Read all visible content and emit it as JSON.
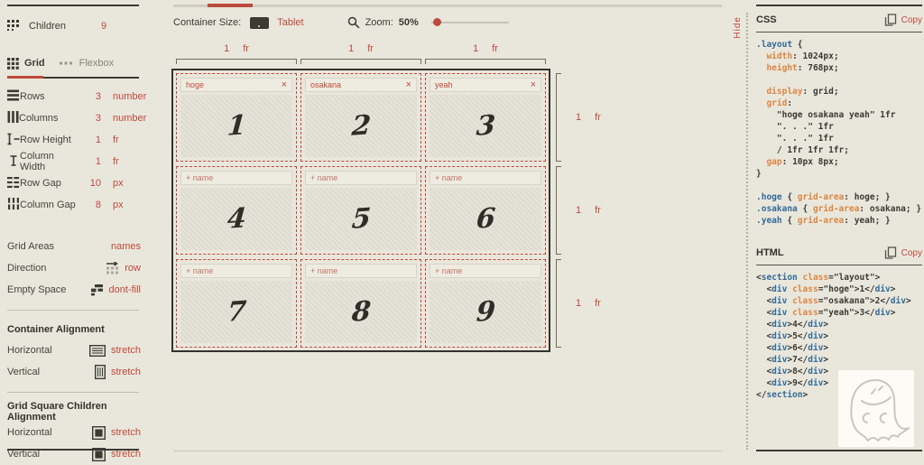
{
  "colors": {
    "accent": "#c0483d",
    "dark": "#3b3a33",
    "background": "#e9e7dc",
    "code_selector_blue": "#336a99",
    "code_property_orange": "#dd8540"
  },
  "sidebar": {
    "children_label": "Children",
    "children_value": "9",
    "tabs": [
      {
        "label": "Grid",
        "icon": "grid-icon",
        "active": true
      },
      {
        "label": "Flexbox",
        "icon": "flexbox-icon",
        "active": false
      }
    ],
    "properties": [
      {
        "icon": "rows-icon",
        "label": "Rows",
        "value": "3",
        "unit": "number"
      },
      {
        "icon": "columns-icon",
        "label": "Columns",
        "value": "3",
        "unit": "number"
      },
      {
        "icon": "row-height-icon",
        "label": "Row Height",
        "value": "1",
        "unit": "fr"
      },
      {
        "icon": "column-width-icon",
        "label": "Column Width",
        "value": "1",
        "unit": "fr"
      },
      {
        "icon": "row-gap-icon",
        "label": "Row Gap",
        "value": "10",
        "unit": "px"
      },
      {
        "icon": "column-gap-icon",
        "label": "Column Gap",
        "value": "8",
        "unit": "px"
      }
    ],
    "options": [
      {
        "label": "Grid Areas",
        "value": "names",
        "icon": null
      },
      {
        "label": "Direction",
        "value": "row",
        "icon": "direction-row-icon"
      },
      {
        "label": "Empty Space",
        "value": "dont-fill",
        "icon": "empty-space-icon"
      }
    ],
    "container_alignment": {
      "heading": "Container Alignment",
      "rows": [
        {
          "label": "Horizontal",
          "value": "stretch",
          "icon": "align-horizontal-icon"
        },
        {
          "label": "Vertical",
          "value": "stretch",
          "icon": "align-vertical-icon"
        }
      ]
    },
    "children_alignment": {
      "heading": "Grid Square Children Alignment",
      "rows": [
        {
          "label": "Horizontal",
          "value": "stretch",
          "icon": "square-icon"
        },
        {
          "label": "Vertical",
          "value": "stretch",
          "icon": "square-icon"
        }
      ]
    }
  },
  "toolbar": {
    "container_size_label": "Container Size:",
    "container_size_value": "Tablet",
    "zoom_label": "Zoom:",
    "zoom_value": "50%"
  },
  "canvas": {
    "column_labels": [
      {
        "value": "1",
        "unit": "fr"
      },
      {
        "value": "1",
        "unit": "fr"
      },
      {
        "value": "1",
        "unit": "fr"
      }
    ],
    "row_labels": [
      {
        "value": "1",
        "unit": "fr"
      },
      {
        "value": "1",
        "unit": "fr"
      },
      {
        "value": "1",
        "unit": "fr"
      }
    ],
    "cells": [
      {
        "number": "1",
        "name": "hoge"
      },
      {
        "number": "2",
        "name": "osakana"
      },
      {
        "number": "3",
        "name": "yeah"
      },
      {
        "number": "4",
        "placeholder": "+ name"
      },
      {
        "number": "5",
        "placeholder": "+ name"
      },
      {
        "number": "6",
        "placeholder": "+ name"
      },
      {
        "number": "7",
        "placeholder": "+ name"
      },
      {
        "number": "8",
        "placeholder": "+ name"
      },
      {
        "number": "9",
        "placeholder": "+ name"
      }
    ]
  },
  "hide_label": "Hide",
  "css_panel": {
    "title": "CSS",
    "copy_label": "Copy",
    "code": [
      [
        {
          "t": ".layout",
          "c": "sel"
        },
        {
          "t": " {"
        }
      ],
      [
        {
          "t": "  "
        },
        {
          "t": "width",
          "c": "prop"
        },
        {
          "t": ": 1024px;"
        }
      ],
      [
        {
          "t": "  "
        },
        {
          "t": "height",
          "c": "prop"
        },
        {
          "t": ": 768px;"
        }
      ],
      [],
      [
        {
          "t": "  "
        },
        {
          "t": "display",
          "c": "prop"
        },
        {
          "t": ": grid;"
        }
      ],
      [
        {
          "t": "  "
        },
        {
          "t": "grid",
          "c": "prop"
        },
        {
          "t": ":"
        }
      ],
      [
        {
          "t": "    \"hoge osakana yeah\" 1fr"
        }
      ],
      [
        {
          "t": "    \". . .\" 1fr"
        }
      ],
      [
        {
          "t": "    \". . .\" 1fr"
        }
      ],
      [
        {
          "t": "    / 1fr 1fr 1fr;"
        }
      ],
      [
        {
          "t": "  "
        },
        {
          "t": "gap",
          "c": "prop"
        },
        {
          "t": ": 10px 8px;"
        }
      ],
      [
        {
          "t": "}"
        }
      ],
      [],
      [
        {
          "t": ".hoge",
          "c": "sel"
        },
        {
          "t": " { "
        },
        {
          "t": "grid-area",
          "c": "prop"
        },
        {
          "t": ": hoge; }"
        }
      ],
      [
        {
          "t": ".osakana",
          "c": "sel"
        },
        {
          "t": " { "
        },
        {
          "t": "grid-area",
          "c": "prop"
        },
        {
          "t": ": osakana; }"
        }
      ],
      [
        {
          "t": ".yeah",
          "c": "sel"
        },
        {
          "t": " { "
        },
        {
          "t": "grid-area",
          "c": "prop"
        },
        {
          "t": ": yeah; }"
        }
      ]
    ]
  },
  "html_panel": {
    "title": "HTML",
    "copy_label": "Copy",
    "code": [
      [
        {
          "t": "<"
        },
        {
          "t": "section",
          "c": "tag"
        },
        {
          "t": " "
        },
        {
          "t": "class",
          "c": "attr"
        },
        {
          "t": "=\"layout\">"
        }
      ],
      [
        {
          "t": "  <"
        },
        {
          "t": "div",
          "c": "tag"
        },
        {
          "t": " "
        },
        {
          "t": "class",
          "c": "attr"
        },
        {
          "t": "=\"hoge\">1</"
        },
        {
          "t": "div",
          "c": "tag"
        },
        {
          "t": ">"
        }
      ],
      [
        {
          "t": "  <"
        },
        {
          "t": "div",
          "c": "tag"
        },
        {
          "t": " "
        },
        {
          "t": "class",
          "c": "attr"
        },
        {
          "t": "=\"osakana\">2</"
        },
        {
          "t": "div",
          "c": "tag"
        },
        {
          "t": ">"
        }
      ],
      [
        {
          "t": "  <"
        },
        {
          "t": "div",
          "c": "tag"
        },
        {
          "t": " "
        },
        {
          "t": "class",
          "c": "attr"
        },
        {
          "t": "=\"yeah\">3</"
        },
        {
          "t": "div",
          "c": "tag"
        },
        {
          "t": ">"
        }
      ],
      [
        {
          "t": "  <"
        },
        {
          "t": "div",
          "c": "tag"
        },
        {
          "t": ">4</"
        },
        {
          "t": "div",
          "c": "tag"
        },
        {
          "t": ">"
        }
      ],
      [
        {
          "t": "  <"
        },
        {
          "t": "div",
          "c": "tag"
        },
        {
          "t": ">5</"
        },
        {
          "t": "div",
          "c": "tag"
        },
        {
          "t": ">"
        }
      ],
      [
        {
          "t": "  <"
        },
        {
          "t": "div",
          "c": "tag"
        },
        {
          "t": ">6</"
        },
        {
          "t": "div",
          "c": "tag"
        },
        {
          "t": ">"
        }
      ],
      [
        {
          "t": "  <"
        },
        {
          "t": "div",
          "c": "tag"
        },
        {
          "t": ">7</"
        },
        {
          "t": "div",
          "c": "tag"
        },
        {
          "t": ">"
        }
      ],
      [
        {
          "t": "  <"
        },
        {
          "t": "div",
          "c": "tag"
        },
        {
          "t": ">8</"
        },
        {
          "t": "div",
          "c": "tag"
        },
        {
          "t": ">"
        }
      ],
      [
        {
          "t": "  <"
        },
        {
          "t": "div",
          "c": "tag"
        },
        {
          "t": ">9</"
        },
        {
          "t": "div",
          "c": "tag"
        },
        {
          "t": ">"
        }
      ],
      [
        {
          "t": "</"
        },
        {
          "t": "section",
          "c": "tag"
        },
        {
          "t": ">"
        }
      ]
    ]
  }
}
